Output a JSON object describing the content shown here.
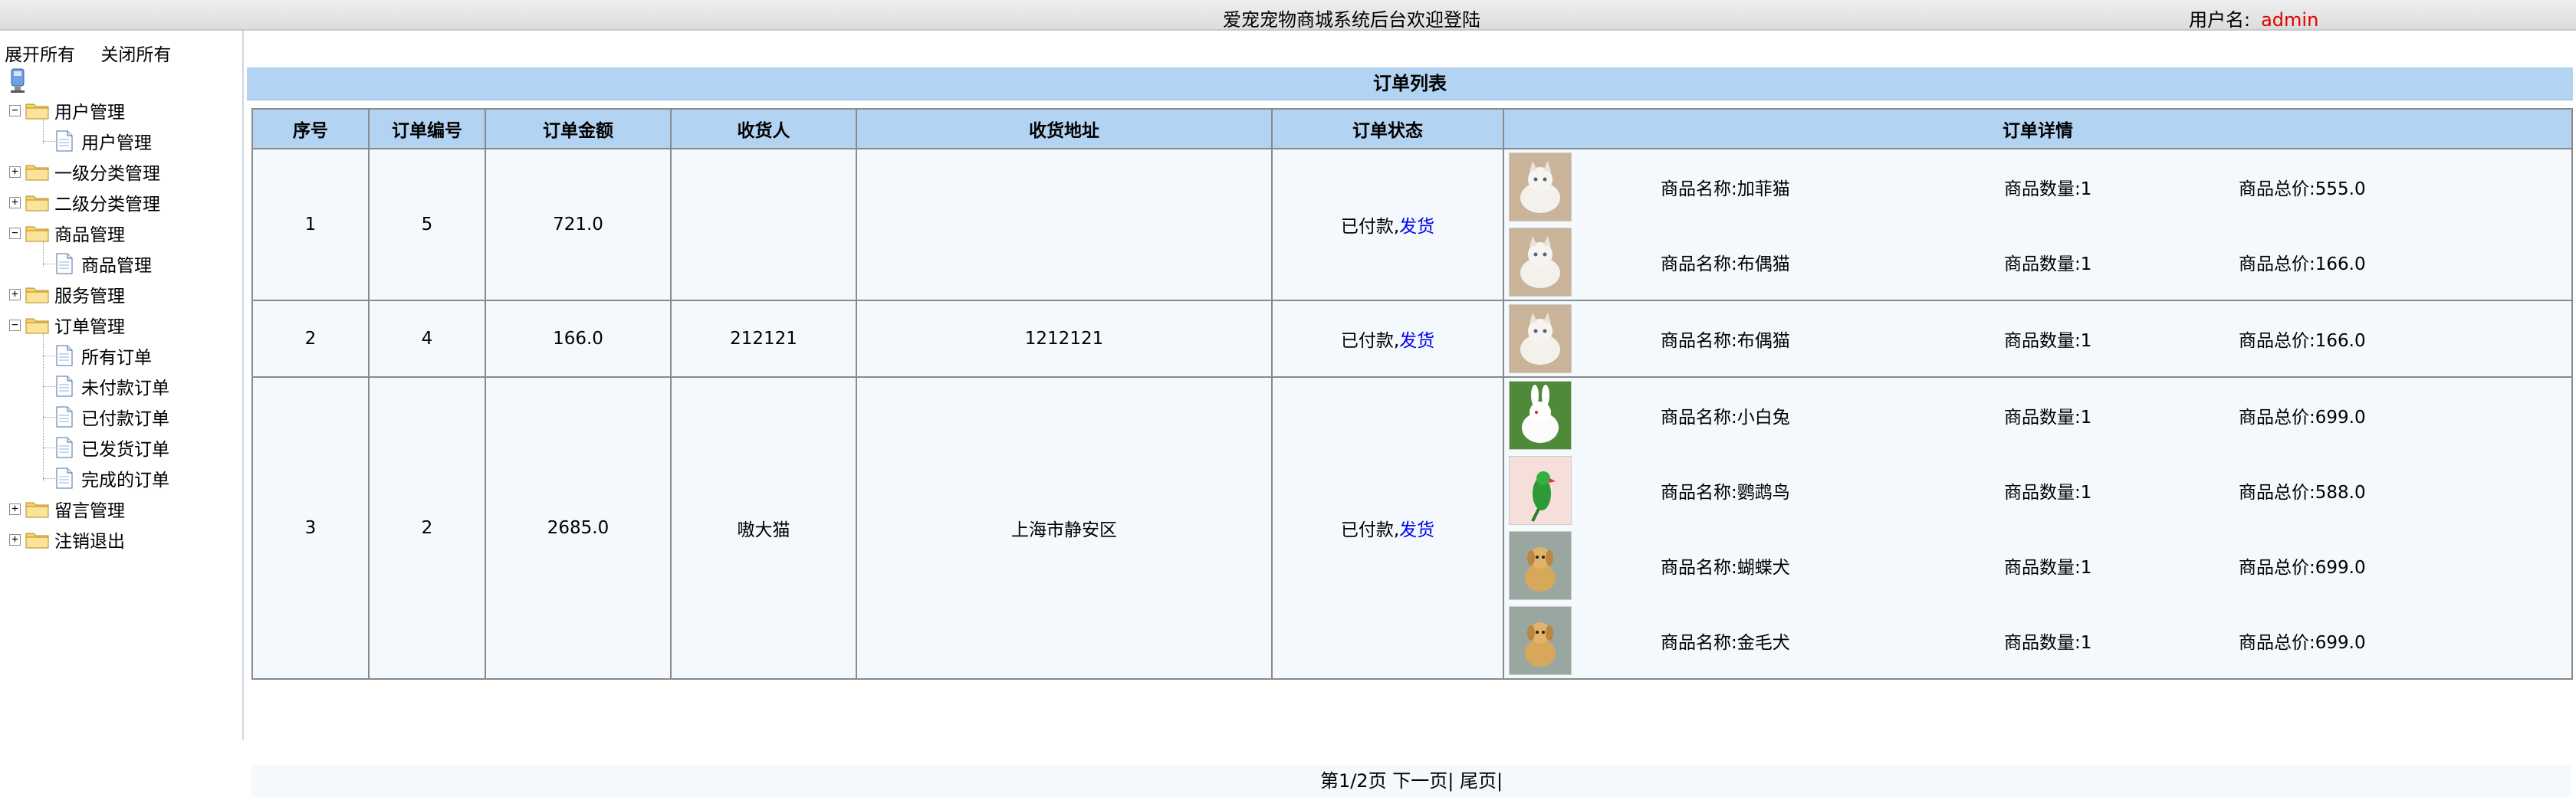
{
  "header": {
    "title": "爱宠宠物商城系统后台欢迎登陆",
    "user_label": "用户名:",
    "username": "admin"
  },
  "sidebar": {
    "expand_all": "展开所有",
    "collapse_all": "关闭所有",
    "tree": [
      {
        "label": "用户管理",
        "expanded": true,
        "children": [
          "用户管理"
        ]
      },
      {
        "label": "一级分类管理",
        "expanded": false,
        "children": []
      },
      {
        "label": "二级分类管理",
        "expanded": false,
        "children": []
      },
      {
        "label": "商品管理",
        "expanded": true,
        "children": [
          "商品管理"
        ]
      },
      {
        "label": "服务管理",
        "expanded": false,
        "children": []
      },
      {
        "label": "订单管理",
        "expanded": true,
        "children": [
          "所有订单",
          "未付款订单",
          "已付款订单",
          "已发货订单",
          "完成的订单"
        ]
      },
      {
        "label": "留言管理",
        "expanded": false,
        "children": []
      },
      {
        "label": "注销退出",
        "expanded": false,
        "children": []
      }
    ]
  },
  "orders": {
    "caption": "订单列表",
    "columns": [
      "序号",
      "订单编号",
      "订单金额",
      "收货人",
      "收货地址",
      "订单状态",
      "订单详情"
    ],
    "detail_labels": {
      "name": "商品名称:",
      "qty": "商品数量:",
      "total": "商品总价:"
    },
    "rows": [
      {
        "index": "1",
        "order_no": "5",
        "amount": "721.0",
        "receiver": "",
        "address": "",
        "status": "已付款,",
        "action": "发货",
        "items": [
          {
            "thumb": "cat-icon",
            "name": "加菲猫",
            "qty": "1",
            "total": "555.0"
          },
          {
            "thumb": "cat-icon",
            "name": "布偶猫",
            "qty": "1",
            "total": "166.0"
          }
        ]
      },
      {
        "index": "2",
        "order_no": "4",
        "amount": "166.0",
        "receiver": "212121",
        "address": "1212121",
        "status": "已付款,",
        "action": "发货",
        "items": [
          {
            "thumb": "cat-icon",
            "name": "布偶猫",
            "qty": "1",
            "total": "166.0"
          }
        ]
      },
      {
        "index": "3",
        "order_no": "2",
        "amount": "2685.0",
        "receiver": "嗷大猫",
        "address": "上海市静安区",
        "status": "已付款,",
        "action": "发货",
        "items": [
          {
            "thumb": "rabbit-icon",
            "name": "小白兔",
            "qty": "1",
            "total": "699.0"
          },
          {
            "thumb": "parrot-icon",
            "name": "鹦鹉鸟",
            "qty": "1",
            "total": "588.0"
          },
          {
            "thumb": "dog-icon",
            "name": "蝴蝶犬",
            "qty": "1",
            "total": "699.0"
          },
          {
            "thumb": "dog-icon",
            "name": "金毛犬",
            "qty": "1",
            "total": "699.0"
          }
        ]
      }
    ],
    "pager": {
      "page_info": "第1/2页",
      "next": "下一页|",
      "last": "尾页|"
    }
  }
}
